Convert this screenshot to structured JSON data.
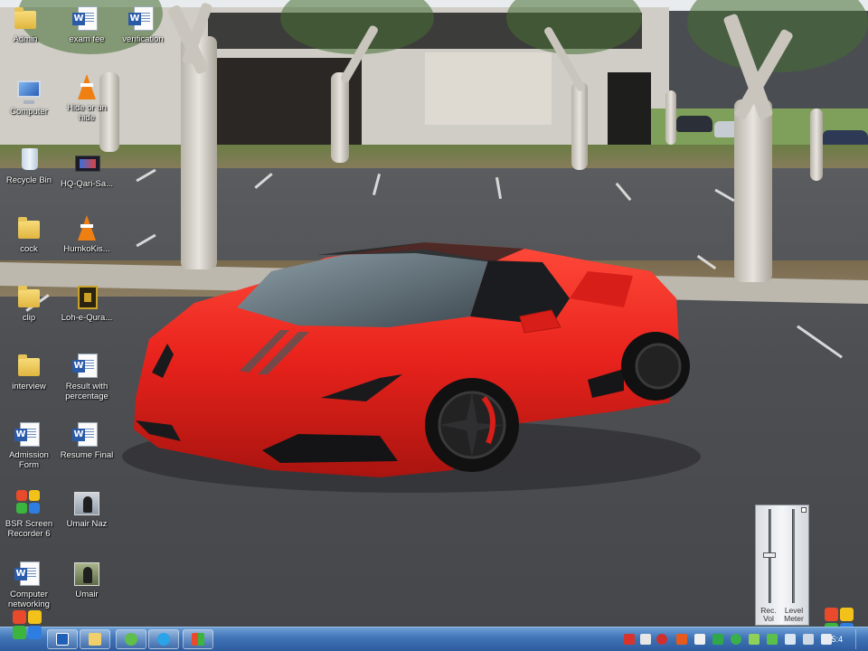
{
  "desktop": {
    "icons": [
      {
        "id": "admin",
        "label": "Admin",
        "type": "folder-icon"
      },
      {
        "id": "exam-fee",
        "label": "exam fee",
        "type": "word-doc-icon"
      },
      {
        "id": "verification",
        "label": "verification",
        "type": "word-doc-icon"
      },
      {
        "id": "computer",
        "label": "Computer",
        "type": "computer-icon"
      },
      {
        "id": "hide-or-un-hide",
        "label_line1": "Hide or un",
        "label_line2": "hide",
        "type": "vlc-cone-icon"
      },
      {
        "id": "recycle-bin",
        "label": "Recycle Bin",
        "type": "recycle-bin-icon"
      },
      {
        "id": "hq-qari",
        "label": "HQ-Qari-Sa...",
        "type": "video-file-icon"
      },
      {
        "id": "cock",
        "label": "cock",
        "type": "folder-icon"
      },
      {
        "id": "humko-kis",
        "label": "HumkoKis...",
        "type": "vlc-cone-icon"
      },
      {
        "id": "clip",
        "label": "clip",
        "type": "folder-icon"
      },
      {
        "id": "loh-e-qura",
        "label": "Loh-e-Qura...",
        "type": "book-icon"
      },
      {
        "id": "interview",
        "label": "interview",
        "type": "folder-icon"
      },
      {
        "id": "result-with-percentage",
        "label_line1": "Result with",
        "label_line2": "percentage",
        "type": "word-doc-icon"
      },
      {
        "id": "admission-form",
        "label_line1": "Admission",
        "label_line2": "Form",
        "type": "word-doc-icon"
      },
      {
        "id": "resume-final",
        "label": "Resume Final",
        "type": "word-doc-icon"
      },
      {
        "id": "bsr-screen-recorder",
        "label_line1": "BSR Screen",
        "label_line2": "Recorder 6",
        "type": "bsr-recorder-icon"
      },
      {
        "id": "umair-naz",
        "label": "Umair Naz",
        "type": "photo-icon"
      },
      {
        "id": "computer-networking",
        "label_line1": "Computer",
        "label_line2": "networking",
        "type": "word-doc-icon"
      },
      {
        "id": "umair",
        "label": "Umair",
        "type": "photo-icon"
      }
    ]
  },
  "volume_widget": {
    "rec_vol_line1": "Rec.",
    "rec_vol_line2": "Vol",
    "level_meter_line1": "Level",
    "level_meter_line2": "Meter"
  },
  "taskbar": {
    "buttons": [
      "outlook-icon",
      "explorer-folder-icon",
      "vlc-icon",
      "skype-icon",
      "bsr-recorder-icon"
    ],
    "clock": "5:4"
  },
  "colors": {
    "taskbar": "#3f73b6",
    "car_body": "#e8221c"
  }
}
